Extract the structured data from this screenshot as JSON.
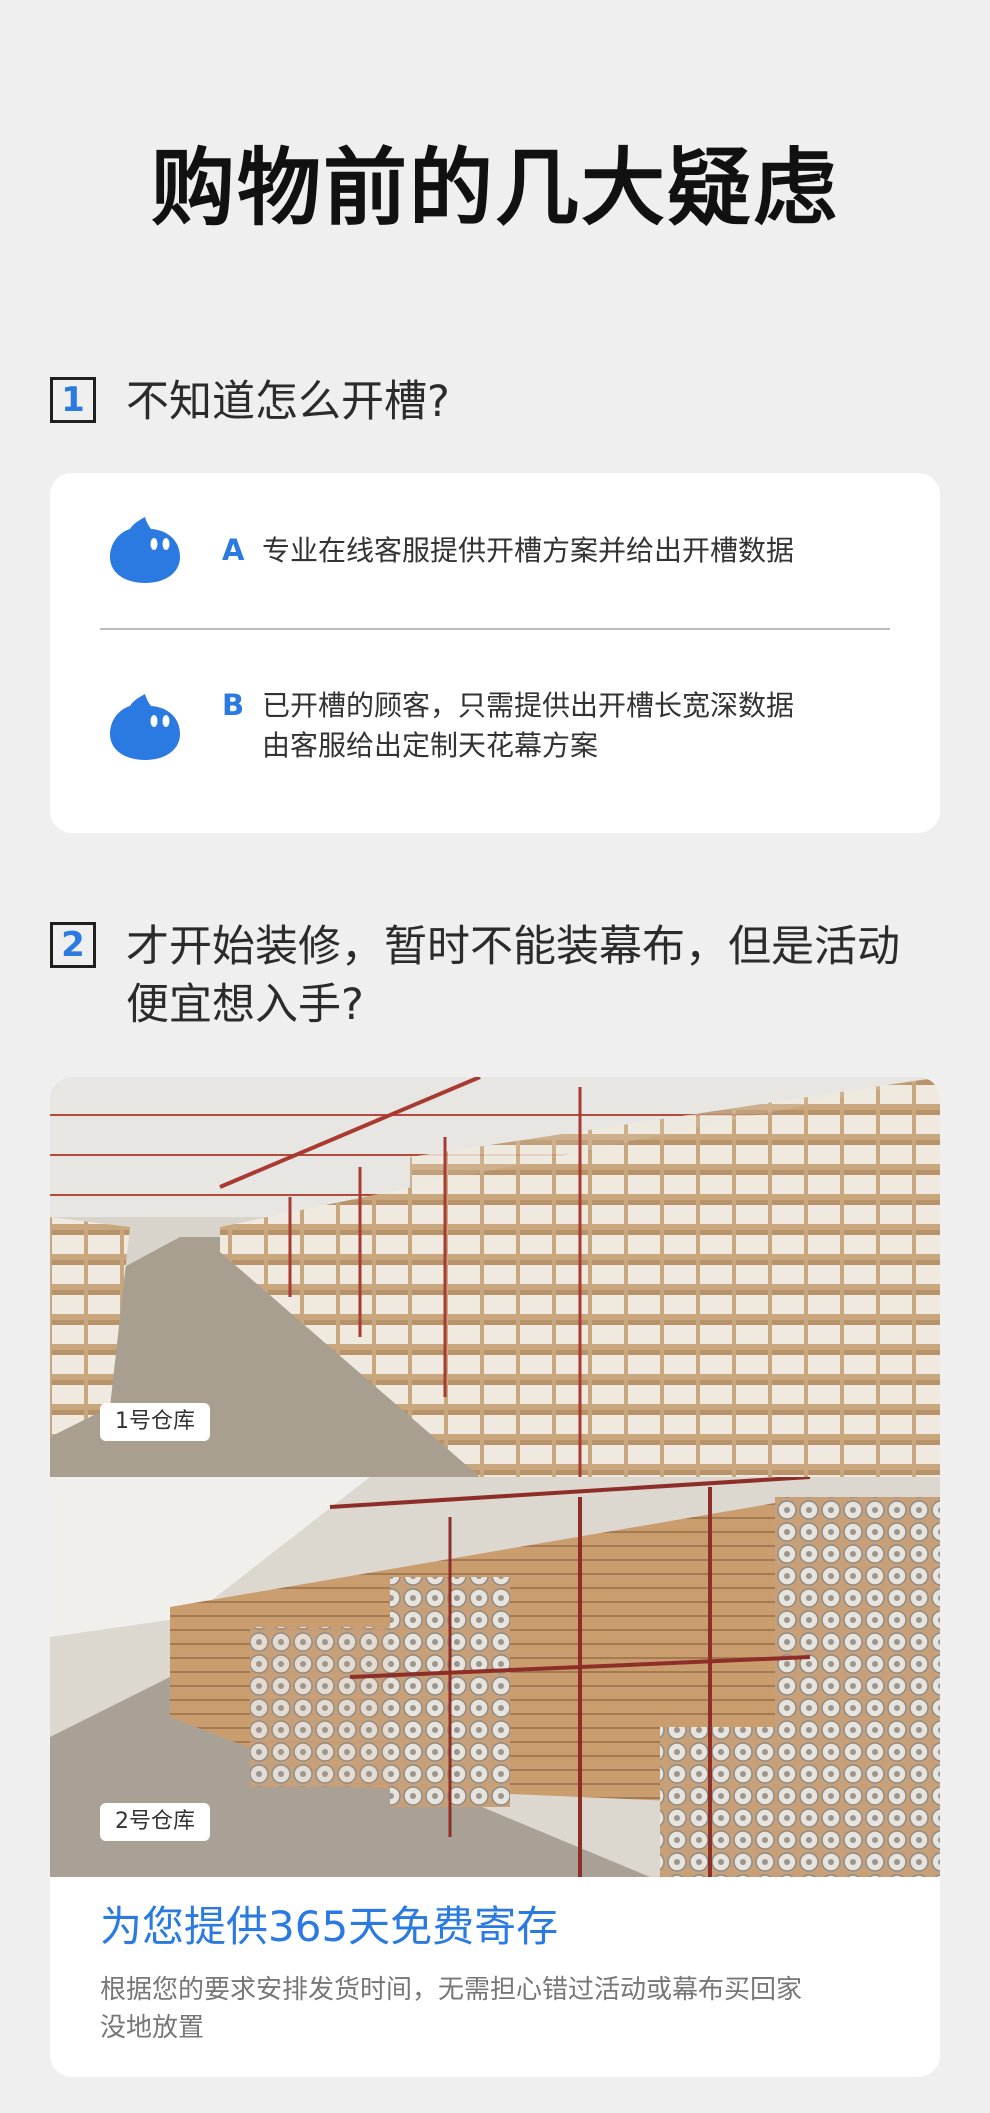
{
  "title": "购物前的几大疑虑",
  "q1": {
    "number": "1",
    "question": "不知道怎么开槽?",
    "answers": [
      {
        "letter": "A",
        "text": "专业在线客服提供开槽方案并给出开槽数据"
      },
      {
        "letter": "B",
        "text": "已开槽的顾客，只需提供出开槽长宽深数据",
        "text2": "由客服给出定制天花幕方案"
      }
    ]
  },
  "q2": {
    "number": "2",
    "question": "才开始装修，暂时不能装幕布，但是活动便宜想入手?",
    "photos": [
      {
        "label": "1号仓库"
      },
      {
        "label": "2号仓库"
      }
    ],
    "headline": "为您提供365天免费寄存",
    "description": "根据您的要求安排发货时间，无需担心错过活动或幕布买回家没地放置"
  },
  "colors": {
    "accent": "#2a7ae2",
    "background": "#efefef",
    "card": "#ffffff"
  }
}
